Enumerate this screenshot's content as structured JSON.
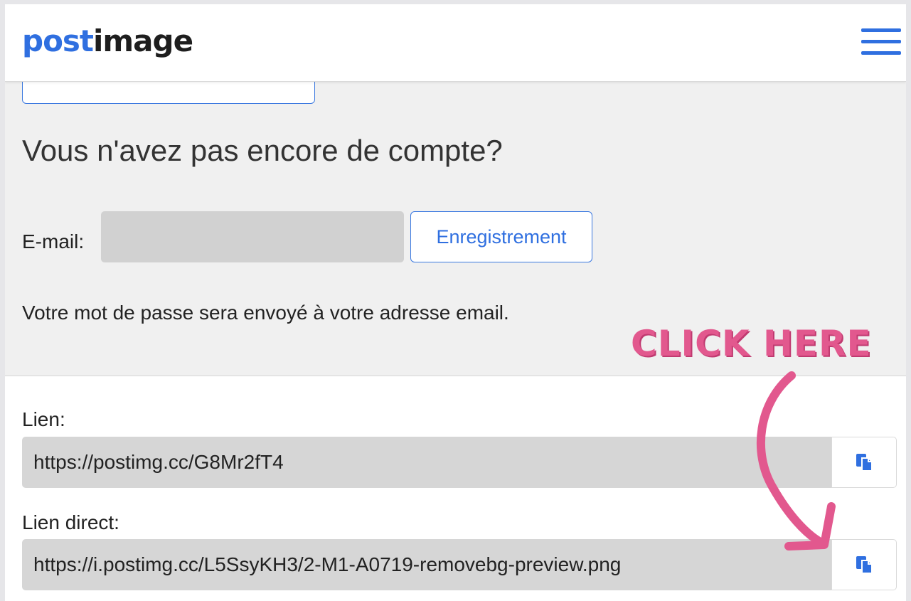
{
  "header": {
    "logo_part1": "post",
    "logo_part2": "image",
    "menu_icon": "hamburger-menu-icon"
  },
  "signup": {
    "title": "Vous n'avez pas encore de compte?",
    "email_label": "E-mail:",
    "email_value": "",
    "register_label": "Enregistrement",
    "hint": "Votre mot de passe sera envoyé à votre adresse email."
  },
  "links": [
    {
      "label": "Lien:",
      "value": "https://postimg.cc/G8Mr2fT4",
      "copy_icon": "copy-icon"
    },
    {
      "label": "Lien direct:",
      "value": "https://i.postimg.cc/L5SsyKH3/2-M1-A0719-removebg-preview.png",
      "copy_icon": "copy-icon"
    }
  ],
  "annotation": {
    "text": "CLICK HERE",
    "color": "#e2588e",
    "arrow_icon": "curved-arrow-icon"
  },
  "colors": {
    "brand": "#2f6fe0",
    "field_bg": "#d6d6d6",
    "section_bg": "#f0f0f0"
  }
}
